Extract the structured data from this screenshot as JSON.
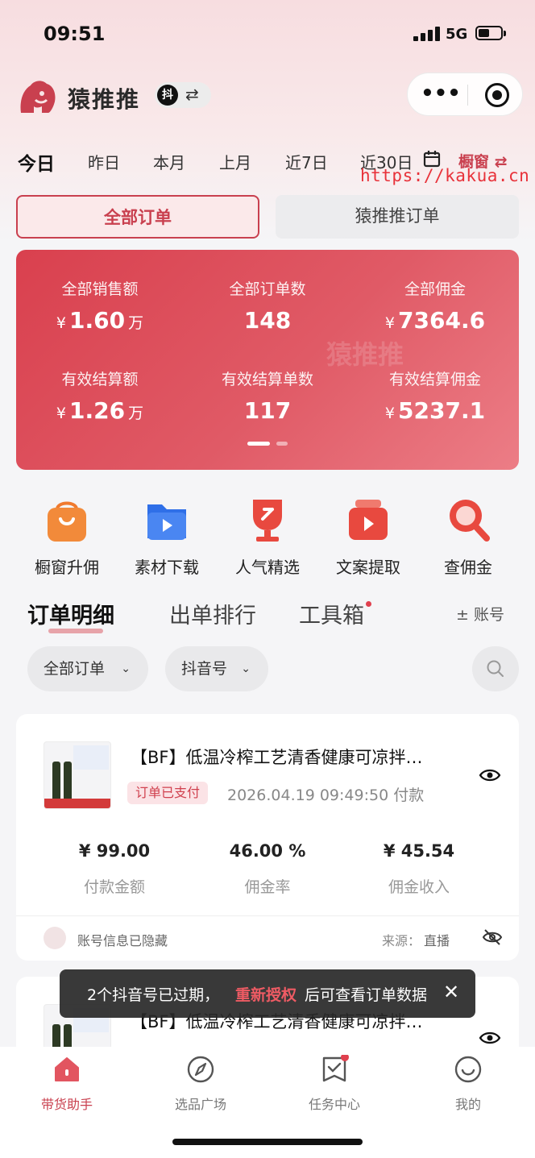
{
  "status_bar": {
    "time": "09:51",
    "network": "5G"
  },
  "header": {
    "app_name": "猿推推",
    "platform_badge": "抖",
    "switch_icon": "⇄",
    "more_icon": "•••",
    "icons": {
      "logo": "gorilla-logo-icon",
      "more": "more-dots-icon",
      "close": "miniapp-close-icon"
    }
  },
  "date_filter": {
    "tabs": [
      "今日",
      "昨日",
      "本月",
      "上月",
      "近7日",
      "近30日"
    ],
    "active_index": 0,
    "showcase_label": "橱窗 ⇄"
  },
  "watermark": "https://kakua.cn",
  "order_type_tabs": {
    "all": "全部订单",
    "yuantuitui": "猿推推订单",
    "active": "all"
  },
  "stats": {
    "watermark": "猿推推",
    "currency": "¥",
    "unit_wan": "万",
    "items": [
      {
        "label": "全部销售额",
        "value": "1.60",
        "currency": true,
        "unit": true
      },
      {
        "label": "全部订单数",
        "value": "148",
        "currency": false,
        "unit": false
      },
      {
        "label": "全部佣金",
        "value": "7364.6",
        "currency": true,
        "unit": false
      },
      {
        "label": "有效结算额",
        "value": "1.26",
        "currency": true,
        "unit": true
      },
      {
        "label": "有效结算单数",
        "value": "117",
        "currency": false,
        "unit": false
      },
      {
        "label": "有效结算佣金",
        "value": "5237.1",
        "currency": true,
        "unit": false
      }
    ],
    "page_count": 2,
    "page_index": 0
  },
  "quick_actions": [
    {
      "label": "橱窗升佣",
      "icon": "shopping-bag-icon",
      "color": "#f07a2e"
    },
    {
      "label": "素材下载",
      "icon": "video-folder-icon",
      "color": "#2f6fe8"
    },
    {
      "label": "人气精选",
      "icon": "trophy-icon",
      "color": "#e8493f"
    },
    {
      "label": "文案提取",
      "icon": "video-extract-icon",
      "color": "#e8493f"
    },
    {
      "label": "查佣金",
      "icon": "magnifier-icon",
      "color": "#e8493f"
    }
  ],
  "sections": {
    "tabs": [
      "订单明细",
      "出单排行",
      "工具箱"
    ],
    "active_index": 0,
    "account_button": "± 账号"
  },
  "filters": {
    "order_filter": "全部订单",
    "account_filter": "抖音号"
  },
  "orders": [
    {
      "title": "【BF】低温冷榨工艺清香健康可凉拌…",
      "status": "订单已支付",
      "time": "2026.04.19 09:49:50 付款",
      "amount": "¥ 99.00",
      "amount_label": "付款金额",
      "rate": "46.00 %",
      "rate_label": "佣金率",
      "income": "¥ 45.54",
      "income_label": "佣金收入",
      "account_info": "账号信息已隐藏",
      "source_label": "来源：",
      "source_value": "直播"
    },
    {
      "title": "【BF】低温冷榨工艺清香健康可凉拌…"
    }
  ],
  "toast": {
    "text": "2个抖音号已过期，",
    "link": "重新授权",
    "text_after": "后可查看订单数据",
    "close": "✕"
  },
  "tab_bar": [
    {
      "label": "带货助手",
      "icon": "home-icon",
      "active": true
    },
    {
      "label": "选品广场",
      "icon": "compass-icon",
      "active": false
    },
    {
      "label": "任务中心",
      "icon": "task-check-icon",
      "active": false,
      "dot": true
    },
    {
      "label": "我的",
      "icon": "smile-icon",
      "active": false
    }
  ],
  "colors": {
    "accent": "#c9404f",
    "card_gradient_start": "#d9404e",
    "card_gradient_end": "#ec7d86",
    "watermark": "#e8323a"
  }
}
